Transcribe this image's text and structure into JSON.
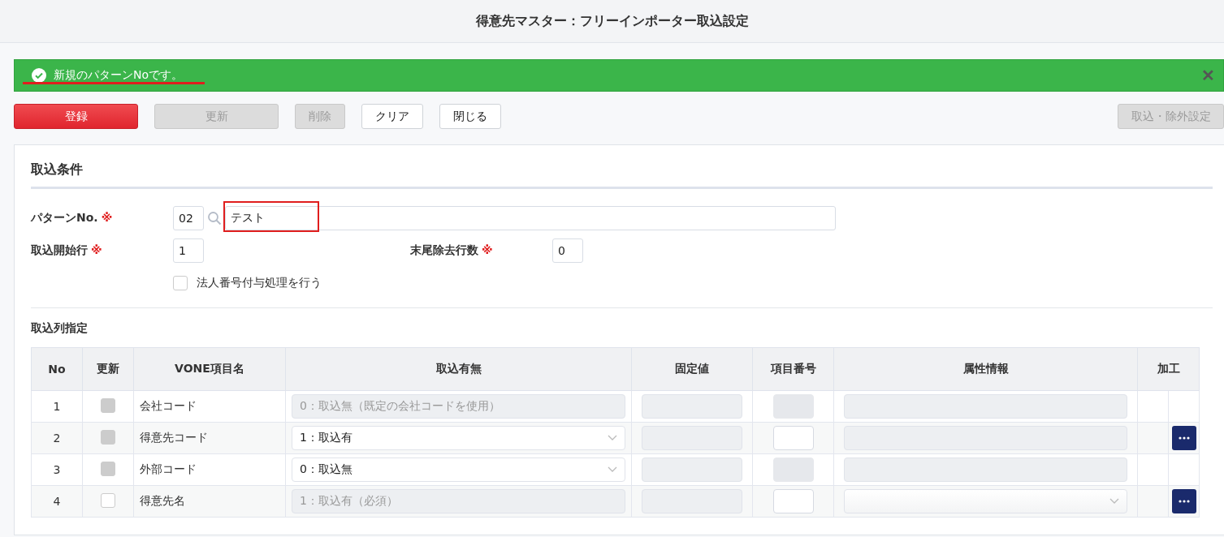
{
  "window": {
    "title": "得意先マスター：フリーインポーター取込設定"
  },
  "alert": {
    "message": "新規のパターンNoです。",
    "close": "✕"
  },
  "toolbar": {
    "buttons": [
      {
        "label": "登録",
        "kind": "primary",
        "disabled": false
      },
      {
        "label": "更新",
        "kind": "wide",
        "disabled": true
      },
      {
        "label": "削除",
        "kind": "normal",
        "disabled": true
      },
      {
        "label": "クリア",
        "kind": "normal",
        "disabled": false
      },
      {
        "label": "閉じる",
        "kind": "normal",
        "disabled": false
      }
    ],
    "right_button": {
      "label": "取込・除外設定",
      "disabled": true
    }
  },
  "conditions": {
    "title": "取込条件",
    "pattern": {
      "label": "パターンNo.",
      "required_mark": "※",
      "code": "02",
      "name": "テスト"
    },
    "start_row": {
      "label": "取込開始行",
      "required_mark": "※",
      "value": "1"
    },
    "trailing_rows": {
      "label": "末尾除去行数",
      "required_mark": "※",
      "value": "0"
    },
    "corporate_number": {
      "label": "法人番号付与処理を行う",
      "checked": false
    }
  },
  "columns_section": {
    "title": "取込列指定",
    "columns": [
      "No",
      "更新",
      "VONE項目名",
      "取込有無",
      "固定値",
      "項目番号",
      "属性情報",
      "加工"
    ],
    "rows": [
      {
        "no": "1",
        "update": {
          "checked": false,
          "disabled": true
        },
        "name": "会社コード",
        "import": {
          "kind": "readonly",
          "value": "0：取込無（既定の会社コードを使用）"
        },
        "item_number": {
          "disabled": true
        },
        "attribute": {
          "kind": "readonly"
        },
        "process_button": false
      },
      {
        "no": "2",
        "update": {
          "checked": false,
          "disabled": true
        },
        "name": "得意先コード",
        "import": {
          "kind": "select",
          "value": "1：取込有"
        },
        "item_number": {
          "disabled": false
        },
        "attribute": {
          "kind": "readonly"
        },
        "process_button": true
      },
      {
        "no": "3",
        "update": {
          "checked": false,
          "disabled": true
        },
        "name": "外部コード",
        "import": {
          "kind": "select",
          "value": "0：取込無"
        },
        "item_number": {
          "disabled": true
        },
        "attribute": {
          "kind": "readonly"
        },
        "process_button": false
      },
      {
        "no": "4",
        "update": {
          "checked": false,
          "disabled": false
        },
        "name": "得意先名",
        "import": {
          "kind": "readonly",
          "value": "1：取込有（必須）"
        },
        "item_number": {
          "disabled": false
        },
        "attribute": {
          "kind": "select"
        },
        "process_button": true
      }
    ]
  }
}
